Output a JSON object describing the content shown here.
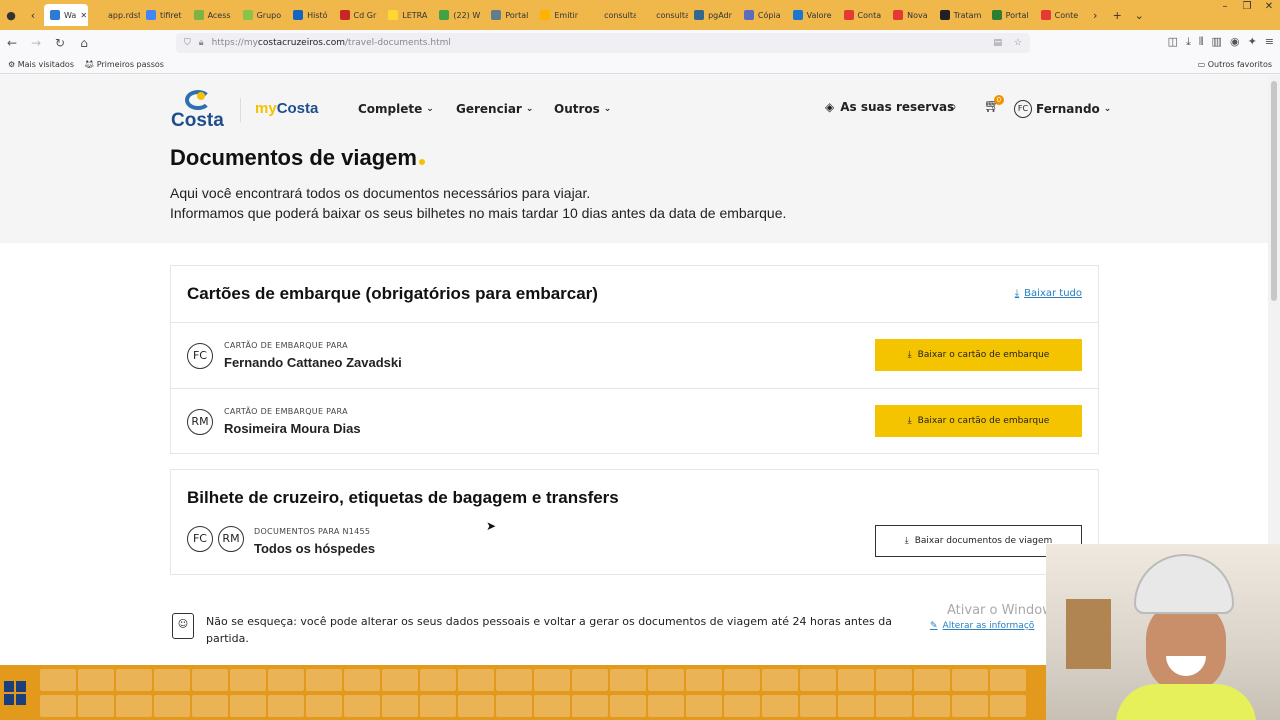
{
  "browser": {
    "tabs": [
      {
        "label": "Wa",
        "color": "#2b7bd6",
        "active": true
      },
      {
        "label": "app.rdstati",
        "color": "#f0b74a"
      },
      {
        "label": "tifiret",
        "color": "#4285f4"
      },
      {
        "label": "Acess",
        "color": "#7cb342"
      },
      {
        "label": "Grupo",
        "color": "#8bc34a"
      },
      {
        "label": "Histó",
        "color": "#1565c0"
      },
      {
        "label": "Cd Gr",
        "color": "#c62828"
      },
      {
        "label": "LETRA",
        "color": "#fdd835"
      },
      {
        "label": "(22) W",
        "color": "#43a047"
      },
      {
        "label": "Portal",
        "color": "#607d8b"
      },
      {
        "label": "Emitir",
        "color": "#ffb300"
      },
      {
        "label": "consultar-",
        "color": "#f0b74a"
      },
      {
        "label": "consulta-",
        "color": "#f0b74a"
      },
      {
        "label": "pgAdr",
        "color": "#336791"
      },
      {
        "label": "Cópia",
        "color": "#5c6bc0"
      },
      {
        "label": "Valore",
        "color": "#1976d2"
      },
      {
        "label": "Conta",
        "color": "#e53935"
      },
      {
        "label": "Nova",
        "color": "#e53935"
      },
      {
        "label": "Tratam",
        "color": "#212121"
      },
      {
        "label": "Portal",
        "color": "#2e7d32"
      },
      {
        "label": "Conte",
        "color": "#e53935"
      }
    ],
    "url_prefix": "https://my",
    "url_host": "costacruzeiros.com",
    "url_path": "/travel-documents.html",
    "bookmarks": {
      "most_visited": "Mais visitados",
      "first_steps": "Primeiros passos",
      "other": "Outros favoritos"
    }
  },
  "header": {
    "logo_text": "Costa",
    "mycosta_my": "my",
    "mycosta_costa": "Costa",
    "menu": [
      {
        "label": "Complete"
      },
      {
        "label": "Gerenciar"
      },
      {
        "label": "Outros"
      }
    ],
    "reservas": "As suas reservas",
    "cart_count": "0",
    "user_initials": "FC",
    "user_name": "Fernando"
  },
  "main": {
    "title": "Documentos de viagem",
    "subtitle_line1": "Aqui você encontrará todos os documentos necessários para viajar.",
    "subtitle_line2": "Informamos que poderá baixar os seus bilhetes no mais tardar 10 dias antes da data de embarque."
  },
  "boarding": {
    "title": "Cartões de embarque (obrigatórios para embarcar)",
    "download_all": "Baixar tudo",
    "passengers": [
      {
        "initials": "FC",
        "label": "CARTÃO DE EMBARQUE PARA",
        "name": "Fernando Cattaneo Zavadski",
        "button": "Baixar o cartão de embarque"
      },
      {
        "initials": "RM",
        "label": "CARTÃO DE EMBARQUE PARA",
        "name": "Rosimeira Moura Dias",
        "button": "Baixar o cartão de embarque"
      }
    ]
  },
  "ticket": {
    "title": "Bilhete de cruzeiro, etiquetas de bagagem e transfers",
    "initials": [
      "FC",
      "RM"
    ],
    "label": "DOCUMENTOS PARA N1455",
    "name": "Todos os hóspedes",
    "button": "Baixar documentos de viagem"
  },
  "note": {
    "text": "Não se esqueça: você pode alterar os seus dados pessoais e voltar a gerar os documentos de viagem até 24 horas antes da partida.",
    "link": "Alterar as informaçõ"
  },
  "watermark": "Ativar o Window"
}
